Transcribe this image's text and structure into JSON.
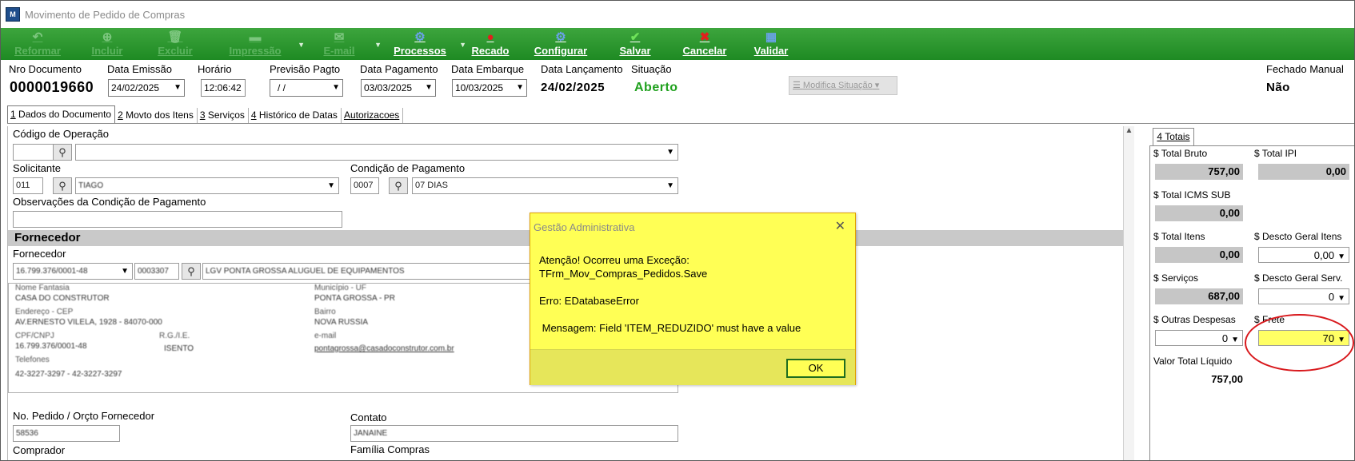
{
  "window": {
    "title": "Movimento de Pedido de Compras",
    "icon_text": "M"
  },
  "toolbar": {
    "items": [
      {
        "label": "Reformar",
        "icon": "undo-icon",
        "glyph": "↶",
        "enabled": false
      },
      {
        "label": "Incluir",
        "icon": "add-icon",
        "glyph": "⊕",
        "enabled": false
      },
      {
        "label": "Excluir",
        "icon": "trash-icon",
        "glyph": "🗑",
        "enabled": false
      },
      {
        "label": "Impressão",
        "icon": "printer-icon",
        "glyph": "▬",
        "enabled": false,
        "dropdown": true
      },
      {
        "label": "E-mail",
        "icon": "email-icon",
        "glyph": "✉",
        "enabled": false,
        "dropdown": true
      },
      {
        "label": "Processos",
        "icon": "process-icon",
        "glyph": "⚙",
        "enabled": true,
        "dropdown": true
      },
      {
        "label": "Recado",
        "icon": "message-icon",
        "glyph": "●",
        "enabled": true
      },
      {
        "label": "Configurar",
        "icon": "config-icon",
        "glyph": "⚙",
        "enabled": true
      },
      {
        "label": "Salvar",
        "icon": "check-icon",
        "glyph": "✔",
        "enabled": true
      },
      {
        "label": "Cancelar",
        "icon": "cancel-icon",
        "glyph": "✖",
        "enabled": true
      },
      {
        "label": "Validar",
        "icon": "validate-icon",
        "glyph": "▦",
        "enabled": true
      }
    ]
  },
  "header": {
    "nro_documento": {
      "label": "Nro Documento",
      "value": "0000019660"
    },
    "data_emissao": {
      "label": "Data Emissão",
      "value": "24/02/2025"
    },
    "horario": {
      "label": "Horário",
      "value": "12:06:42"
    },
    "previsao_pagto": {
      "label": "Previsão Pagto",
      "value": "/ /"
    },
    "data_pagamento": {
      "label": "Data Pagamento",
      "value": "03/03/2025"
    },
    "data_embarque": {
      "label": "Data Embarque",
      "value": "10/03/2025"
    },
    "data_lancamento": {
      "label": "Data Lançamento",
      "value": "24/02/2025"
    },
    "situacao": {
      "label": "Situação",
      "value": "Aberto"
    },
    "modifica_situacao": "Modifica Situação",
    "fechado_manual": {
      "label": "Fechado Manual",
      "value": "Não"
    }
  },
  "tabs": [
    {
      "key": "1",
      "label": " Dados do Documento",
      "active": true
    },
    {
      "key": "2",
      "label": " Movto dos Itens",
      "active": false
    },
    {
      "key": "3",
      "label": " Serviços",
      "active": false
    },
    {
      "key": "4",
      "label": " Histórico de Datas",
      "active": false
    },
    {
      "key": "",
      "label": "Autorizacoes",
      "active": false
    }
  ],
  "form": {
    "codigo_operacao": {
      "label": "Código de Operação",
      "code": "",
      "value": ""
    },
    "solicitante": {
      "label": "Solicitante",
      "code": "011",
      "value": "TIAGO"
    },
    "condicao_pagamento": {
      "label": "Condição de Pagamento",
      "code": "0007",
      "value": "07 DIAS"
    },
    "observacoes": {
      "label": "Observações da Condição de Pagamento",
      "value": ""
    },
    "fornecedor_section": "Fornecedor",
    "fornecedor": {
      "label": "Fornecedor",
      "cnpj": "16.799.376/0001-48",
      "code": "0003307",
      "name": "LGV PONTA GROSSA ALUGUEL DE EQUIPAMENTOS"
    },
    "info": {
      "nome_fantasia_label": "Nome Fantasia",
      "nome_fantasia": "CASA DO CONSTRUTOR",
      "endereco_label": "Endereço - CEP",
      "endereco": "AV.ERNESTO VILELA, 1928 - 84070-000",
      "cpf_label": "CPF/CNPJ",
      "cpf": "16.799.376/0001-48",
      "rgie_label": "R.G./I.E.",
      "rgie": "ISENTO",
      "telefones_label": "Telefones",
      "telefones": "42-3227-3297 - 42-3227-3297",
      "municipio_label": "Município - UF",
      "municipio": "PONTA GROSSA - PR",
      "bairro_label": "Bairro",
      "bairro": "NOVA RUSSIA",
      "email_label": "e-mail",
      "email": "pontagrossa@casadoconstrutor.com.br"
    },
    "pedido_fornecedor": {
      "label": "No. Pedido / Orçto Fornecedor",
      "value": "58536"
    },
    "contato": {
      "label": "Contato",
      "value": "JANAINE"
    },
    "comprador": {
      "label": "Comprador"
    },
    "familia_compras": {
      "label": "Família Compras"
    }
  },
  "totals": {
    "tab_label": "4 Totais",
    "total_bruto": {
      "label": "$ Total Bruto",
      "value": "757,00"
    },
    "total_ipi": {
      "label": "$ Total IPI",
      "value": "0,00"
    },
    "total_icms_sub": {
      "label": "$ Total ICMS SUB",
      "value": "0,00"
    },
    "total_itens": {
      "label": "$ Total Itens",
      "value": "0,00"
    },
    "descto_geral_itens": {
      "label": "$ Descto Geral Itens",
      "value": "0,00"
    },
    "servicos": {
      "label": "$ Serviços",
      "value": "687,00"
    },
    "descto_geral_serv": {
      "label": "$ Descto Geral Serv.",
      "value": "0"
    },
    "outras_despesas": {
      "label": "$ Outras Despesas",
      "value": "0"
    },
    "frete": {
      "label": "$ Frete",
      "value": "70"
    },
    "valor_total_liquido": {
      "label": "Valor Total Líquido",
      "value": "757,00"
    }
  },
  "dialog": {
    "title": "Gestão Administrativa",
    "message": "Atenção! Ocorreu uma Exceção:\nTFrm_Mov_Compras_Pedidos.Save\n\nErro: EDatabaseError\n\n Mensagem: Field 'ITEM_REDUZIDO' must have a value",
    "ok_label": "OK"
  },
  "colors": {
    "toolbar_green": "#1e8a23",
    "status_green": "#21a11f",
    "dialog_yellow": "#ffff55",
    "highlight_yellow": "#ffff64",
    "annotation_red": "#d8181c"
  }
}
